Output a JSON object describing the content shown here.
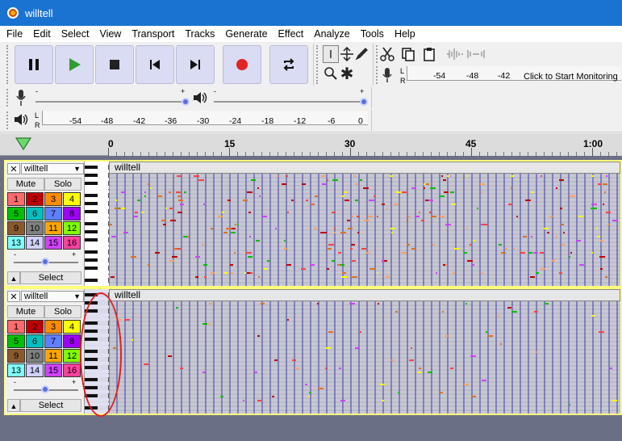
{
  "window": {
    "title": "willtell"
  },
  "menu": [
    "File",
    "Edit",
    "Select",
    "View",
    "Transport",
    "Tracks",
    "Generate",
    "Effect",
    "Analyze",
    "Tools",
    "Help"
  ],
  "recording_meter": {
    "ticks": [
      "-54",
      "-48",
      "-42"
    ],
    "click_label": "Click to Start Monitoring",
    "l": "L",
    "r": "R"
  },
  "playback_meter": {
    "ticks": [
      "-54",
      "-48",
      "-42",
      "-36",
      "-30",
      "-24",
      "-18",
      "-12",
      "-6",
      "0"
    ],
    "l": "L",
    "r": "R"
  },
  "mixer": {
    "minus": "-",
    "plus": "+"
  },
  "timeline": {
    "labels": [
      "0",
      "15",
      "30",
      "45",
      "1:00"
    ]
  },
  "tracks": [
    {
      "name": "willtell",
      "clip_name": "willtell",
      "mute": "Mute",
      "solo": "Solo",
      "select": "Select",
      "vel_minus": "-",
      "vel_plus": "+",
      "channels": [
        "1",
        "2",
        "3",
        "4",
        "5",
        "6",
        "7",
        "8",
        "9",
        "10",
        "11",
        "12",
        "13",
        "14",
        "15",
        "16"
      ]
    },
    {
      "name": "willtell",
      "clip_name": "willtell",
      "mute": "Mute",
      "solo": "Solo",
      "select": "Select",
      "vel_minus": "-",
      "vel_plus": "+",
      "channels": [
        "1",
        "2",
        "3",
        "4",
        "5",
        "6",
        "7",
        "8",
        "9",
        "10",
        "11",
        "12",
        "13",
        "14",
        "15",
        "16"
      ]
    }
  ],
  "channel_colors": [
    "#ff6a6a",
    "#c00000",
    "#ff8c00",
    "#ffff00",
    "#00c000",
    "#00c0c0",
    "#5f7fff",
    "#a000ff",
    "#8b5a2b",
    "#808080",
    "#ffa500",
    "#80ff00",
    "#80ffff",
    "#d0d0ff",
    "#d040ff",
    "#ff40a0"
  ],
  "colors": {
    "titlebar": "#1a73d1",
    "selection": "#ffff7a",
    "annotation": "#e02020"
  }
}
